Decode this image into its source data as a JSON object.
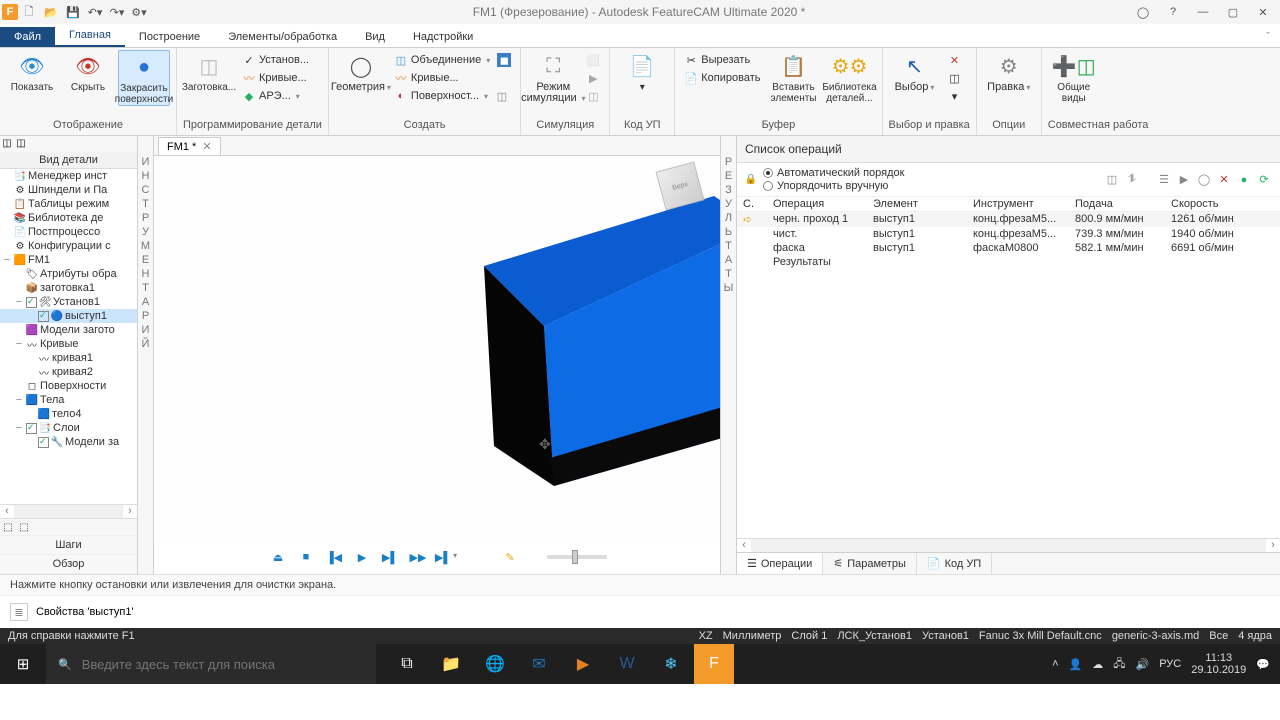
{
  "title": "FM1 (Фрезерование) - Autodesk FeatureCAM Ultimate 2020 *",
  "menu": {
    "file": "Файл",
    "tabs": [
      "Главная",
      "Построение",
      "Элементы/обработка",
      "Вид",
      "Надстройки"
    ]
  },
  "ribbon": {
    "groups": {
      "display": {
        "label": "Отображение",
        "show": "Показать",
        "hide": "Скрыть",
        "shade": "Закрасить\nповерхности"
      },
      "part": {
        "label": "Программирование детали",
        "stock": "Заготовка...",
        "setups": "Установ...",
        "curves": "Кривые...",
        "ars": "АРЭ..."
      },
      "create": {
        "label": "Создать",
        "geometry": "Геометрия",
        "union": "Объединение",
        "crv": "Кривые...",
        "surf": "Поверхност..."
      },
      "sim": {
        "label": "Симуляция",
        "mode": "Режим\nсимуляции"
      },
      "nc": {
        "label": "Код УП"
      },
      "buf": {
        "label": "Буфер",
        "cut": "Вырезать",
        "copy": "Копировать",
        "paste": "Вставить\nэлементы",
        "lib": "Библиотека\nдеталей..."
      },
      "sel": {
        "label": "Выбор и правка",
        "pick": "Выбор",
        "edit": "Правка"
      },
      "opt": {
        "label": "Опции"
      },
      "collab": {
        "label": "Совместная работа",
        "views": "Общие\nвиды"
      }
    }
  },
  "left": {
    "title": "Вид детали",
    "tree": [
      {
        "indent": 0,
        "exp": "",
        "ico": "📑",
        "label": "Менеджер инст"
      },
      {
        "indent": 0,
        "exp": "",
        "ico": "⚙",
        "label": "Шпиндели и Па"
      },
      {
        "indent": 0,
        "exp": "",
        "ico": "📋",
        "label": "Таблицы режим"
      },
      {
        "indent": 0,
        "exp": "",
        "ico": "📚",
        "label": "Библиотека де"
      },
      {
        "indent": 0,
        "exp": "",
        "ico": "📄",
        "label": "Постпроцессо"
      },
      {
        "indent": 0,
        "exp": "",
        "ico": "⚙",
        "label": "Конфигурации с"
      },
      {
        "indent": 0,
        "exp": "−",
        "ico": "🟧",
        "label": "FM1",
        "sel": false
      },
      {
        "indent": 1,
        "exp": "",
        "ico": "🏷",
        "label": "Атрибуты обра"
      },
      {
        "indent": 1,
        "exp": "",
        "ico": "📦",
        "label": "заготовка1"
      },
      {
        "indent": 1,
        "exp": "−",
        "chk": true,
        "ico": "🛠",
        "label": "Установ1"
      },
      {
        "indent": 2,
        "exp": "",
        "chk": true,
        "ico": "🔵",
        "label": "выступ1",
        "sel": true
      },
      {
        "indent": 1,
        "exp": "",
        "ico": "🟪",
        "label": "Модели загото"
      },
      {
        "indent": 1,
        "exp": "−",
        "ico": "〰",
        "label": "Кривые"
      },
      {
        "indent": 2,
        "exp": "",
        "ico": "〰",
        "label": "кривая1"
      },
      {
        "indent": 2,
        "exp": "",
        "ico": "〰",
        "label": "кривая2"
      },
      {
        "indent": 1,
        "exp": "",
        "ico": "◻",
        "label": "Поверхности"
      },
      {
        "indent": 1,
        "exp": "−",
        "ico": "🟦",
        "label": "Тела"
      },
      {
        "indent": 2,
        "exp": "",
        "ico": "🟦",
        "label": "тело4"
      },
      {
        "indent": 1,
        "exp": "−",
        "chk": true,
        "ico": "📑",
        "label": "Слои"
      },
      {
        "indent": 2,
        "exp": "",
        "chk": true,
        "ico": "🔧",
        "label": "Модели за"
      }
    ],
    "footer": [
      "Шаги",
      "Обзор"
    ]
  },
  "vstrip_left": "ИНСТРУМЕНТАРИЙ",
  "vstrip_right": "РЕЗУЛЬТАТЫ",
  "doc_tab": "FM1 *",
  "viewcube": "Верх",
  "ops": {
    "title": "Список операций",
    "order_auto": "Автоматический порядок",
    "order_manual": "Упорядочить вручную",
    "cols": {
      "st": "С.",
      "op": "Операция",
      "el": "Элемент",
      "to": "Инструмент",
      "fd": "Подача",
      "sp": "Скорость"
    },
    "rows": [
      {
        "st": "➪",
        "op": "черн. проход 1",
        "el": "выступ1",
        "to": "конц.фрезаM5...",
        "fd": "800.9 мм/мин",
        "sp": "1261 об/мин"
      },
      {
        "st": "",
        "op": "чист.",
        "el": "выступ1",
        "to": "конц.фрезаM5...",
        "fd": "739.3 мм/мин",
        "sp": "1940 об/мин"
      },
      {
        "st": "",
        "op": "фаска",
        "el": "выступ1",
        "to": "фаскаM0800",
        "fd": "582.1 мм/мин",
        "sp": "6691 об/мин"
      }
    ],
    "results_label": "Результаты",
    "tabs": [
      "Операции",
      "Параметры",
      "Код УП"
    ]
  },
  "msg": "Нажмите кнопку остановки или извлечения для очистки экрана.",
  "prop": "Свойства 'выступ1'",
  "status": {
    "help": "Для справки нажмите F1",
    "items": [
      "XZ",
      "Миллиметр",
      "Слой 1",
      "ЛСК_Установ1",
      "Установ1",
      "Fanuc 3x Mill Default.cnc",
      "generic-3-axis.md",
      "Все",
      "4 ядра"
    ]
  },
  "taskbar": {
    "search_placeholder": "Введите здесь текст для поиска",
    "time": "11:13",
    "date": "29.10.2019",
    "lang": "РУС"
  }
}
